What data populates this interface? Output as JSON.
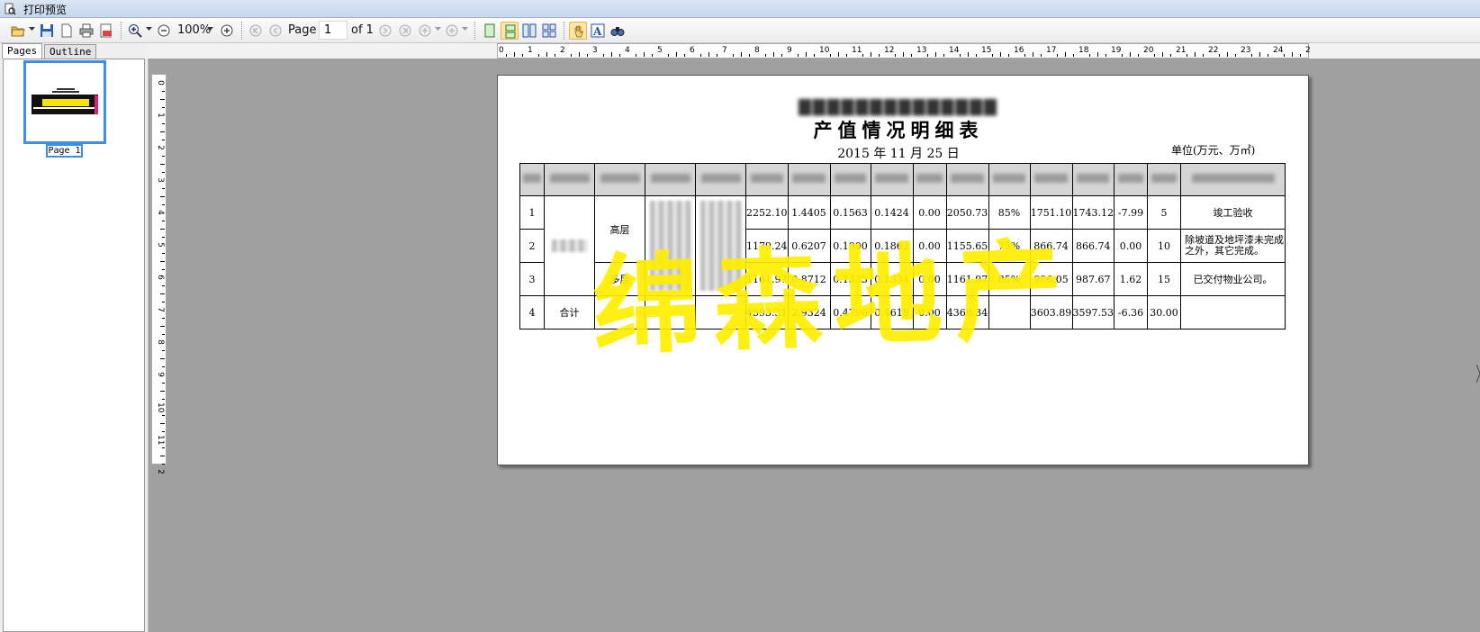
{
  "window": {
    "title": "打印预览"
  },
  "toolbar": {
    "zoom": "100%",
    "page_label": "Page",
    "page_value": "1",
    "of_label": "of 1"
  },
  "panel": {
    "tabs": [
      {
        "label": "Pages"
      },
      {
        "label": "Outline"
      }
    ],
    "thumb_label": "Page 1"
  },
  "hruler": [
    "0",
    "1",
    "2",
    "3",
    "4",
    "5",
    "6",
    "7",
    "8",
    "9",
    "10",
    "11",
    "12",
    "13",
    "14",
    "15",
    "16",
    "17",
    "18",
    "19",
    "20",
    "21",
    "22",
    "23",
    "24",
    "2"
  ],
  "vruler": [
    "0",
    "1",
    "2",
    "3",
    "4",
    "5",
    "6",
    "7",
    "8",
    "9",
    "10",
    "11",
    "2"
  ],
  "doc": {
    "company": "▇▇▇▇▇▇▇▇▇▇▇▇▇▇",
    "title": "产值情况明细表",
    "date": "2015 年 11 月 25 日",
    "unit": "单位(万元、万㎡)",
    "rows": [
      {
        "no": "1",
        "sub": "高层",
        "v1": "2252.10",
        "v2": "1.4405",
        "v3": "0.1563",
        "v4": "0.1424",
        "v5": "0.00",
        "v6": "2050.73",
        "pct": "85%",
        "v7": "1751.10",
        "v8": "1743.12",
        "v9": "-7.99",
        "v10": "5",
        "note": "竣工验收"
      },
      {
        "no": "2",
        "sub": "",
        "v1": "1179.24",
        "v2": "0.6207",
        "v3": "0.1900",
        "v4": "0.1862",
        "v5": "0.00",
        "v6": "1155.65",
        "pct": "75%",
        "v7": "866.74",
        "v8": "866.74",
        "v9": "0.00",
        "v10": "10",
        "note": "除坡道及地坪漆未完成之外，其它完成。"
      },
      {
        "no": "3",
        "sub": "多层",
        "v1": "1161.97",
        "v2": "0.8712",
        "v3": "0.1333",
        "v4": "0.1334",
        "v5": "0.00",
        "v6": "1161.97",
        "pct": "85%",
        "v7": "986.05",
        "v8": "987.67",
        "v9": "1.62",
        "v10": "15",
        "note": "已交付物业公司。"
      },
      {
        "no": "4",
        "sub": "合计",
        "v1": "4593.31",
        "v2": "2.9324",
        "v3": "0.4796",
        "v4": "0.4619",
        "v5": "0.00",
        "v6": "4368.34",
        "pct": "",
        "v7": "3603.89",
        "v8": "3597.53",
        "v9": "-6.36",
        "v10": "30.00",
        "note": ""
      }
    ],
    "watermark": "绵森地产"
  }
}
